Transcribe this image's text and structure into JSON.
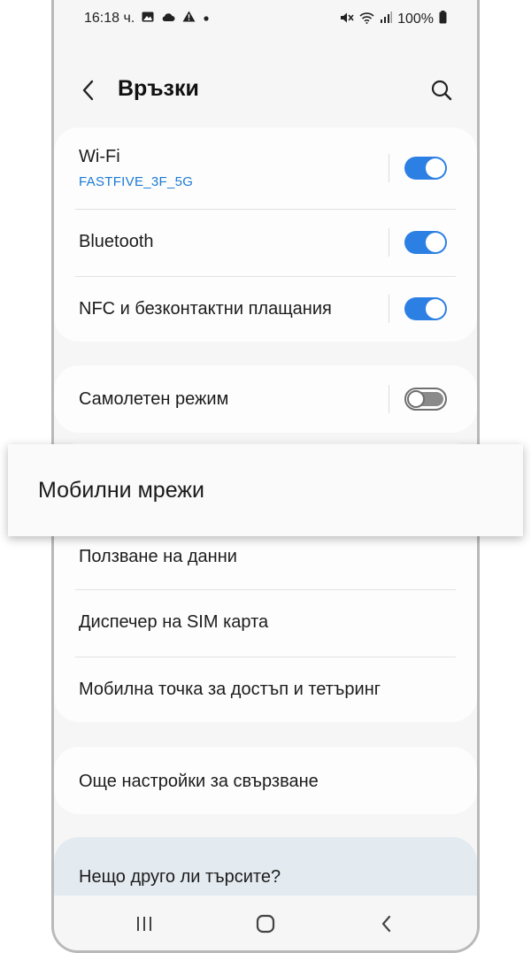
{
  "status": {
    "time": "16:18 ч.",
    "battery": "100%",
    "icons_left": [
      "gallery-icon",
      "cloud-icon",
      "warning-icon",
      "dot-icon"
    ],
    "icons_right": [
      "mute-icon",
      "wifi-icon",
      "signal-icon",
      "battery-icon"
    ]
  },
  "header": {
    "title": "Връзки"
  },
  "connections": [
    {
      "label": "Wi-Fi",
      "sub": "FASTFIVE_3F_5G",
      "toggle": "on"
    },
    {
      "label": "Bluetooth",
      "toggle": "on"
    },
    {
      "label": "NFC и безконтактни плащания",
      "toggle": "on"
    }
  ],
  "airplane": {
    "label": "Самолетен режим",
    "toggle": "off"
  },
  "mobile_networks": {
    "label": "Мобилни мрежи"
  },
  "mobile_items": [
    {
      "label": "Ползване на данни"
    },
    {
      "label": "Диспечер на SIM карта"
    },
    {
      "label": "Мобилна точка за достъп и тетъринг"
    }
  ],
  "more": {
    "label": "Още настройки за свързване"
  },
  "hint": {
    "label": "Нещо друго ли търсите?"
  },
  "colors": {
    "accent": "#2d80e3",
    "wifi_sub": "#1a7ad6",
    "background": "#f6f6f6",
    "hint_card": "#e3eaf0"
  }
}
